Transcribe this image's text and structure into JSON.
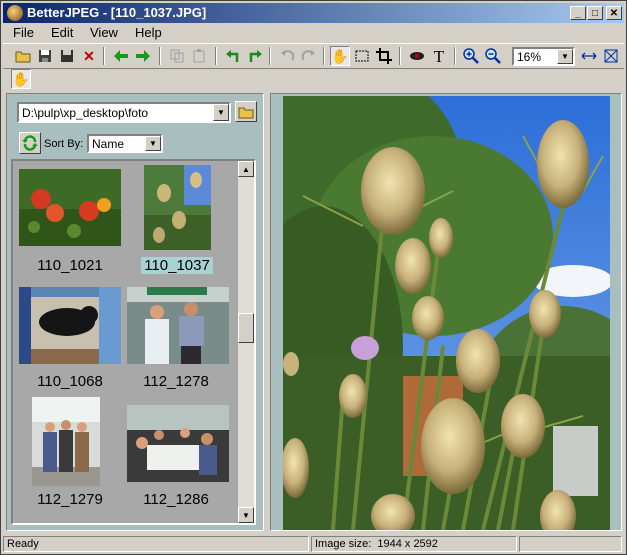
{
  "window": {
    "title": "BetterJPEG - [110_1037.JPG]"
  },
  "titlebar_buttons": {
    "minimize": "_",
    "maximize": "□",
    "close": "✕"
  },
  "menu": {
    "items": [
      "File",
      "Edit",
      "View",
      "Help"
    ]
  },
  "toolbar": {
    "zoom_value": "16%"
  },
  "browser": {
    "path": "D:\\pulp\\xp_desktop\\foto",
    "sort_label": "Sort By:",
    "sort_value": "Name",
    "thumbnails": [
      {
        "name": "110_1021",
        "selected": false
      },
      {
        "name": "110_1037",
        "selected": true
      },
      {
        "name": "110_1068",
        "selected": false
      },
      {
        "name": "112_1278",
        "selected": false
      },
      {
        "name": "112_1279",
        "selected": false
      },
      {
        "name": "112_1286",
        "selected": false
      }
    ]
  },
  "status": {
    "ready": "Ready",
    "image_size": "Image size:  1944 x 2592"
  },
  "colors": {
    "panel_bg": "#a9bfbf",
    "selection": "#a9d2d2",
    "title_start": "#0a246a",
    "title_end": "#a6caf0"
  }
}
